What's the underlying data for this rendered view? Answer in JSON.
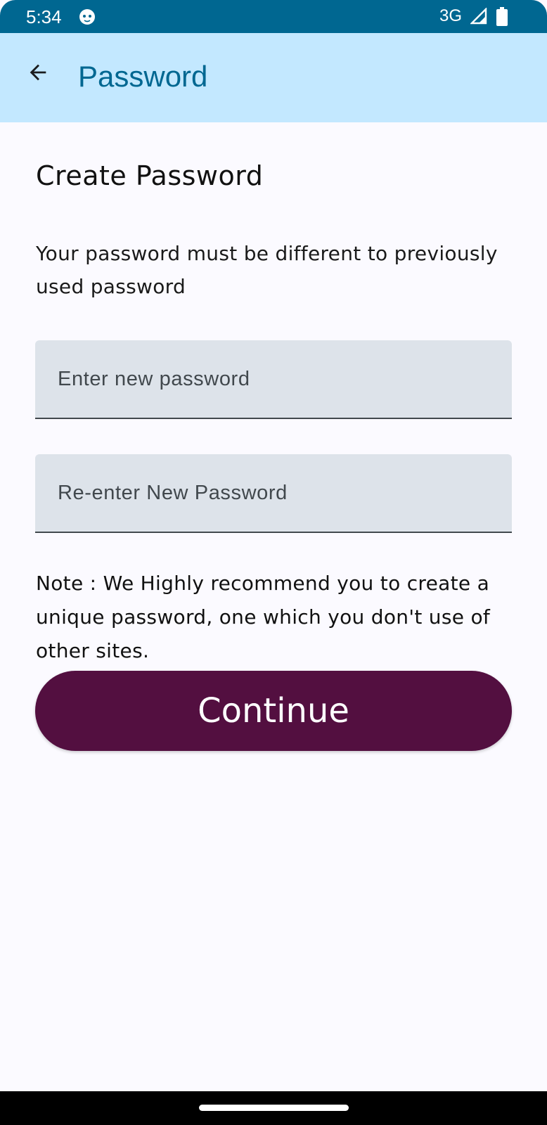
{
  "status_bar": {
    "time": "5:34",
    "network": "3G",
    "app_icon": "android-face-icon",
    "signal_icon": "signal-icon",
    "battery_icon": "battery-icon",
    "background_color": "#006791"
  },
  "app_bar": {
    "title": "Password",
    "back_icon": "arrow-back-icon",
    "background_color": "#c3e8ff",
    "title_color": "#006791"
  },
  "main": {
    "heading": "Create Password",
    "subtitle": "Your password must be different to previously used password",
    "fields": {
      "new_password": {
        "placeholder": "Enter new password",
        "value": ""
      },
      "reenter_password": {
        "placeholder": "Re-enter New Password",
        "value": ""
      }
    },
    "note": "Note : We Highly recommend you to create a unique password, one which you don't use of other sites.",
    "continue_label": "Continue",
    "button_color": "#530f40"
  }
}
